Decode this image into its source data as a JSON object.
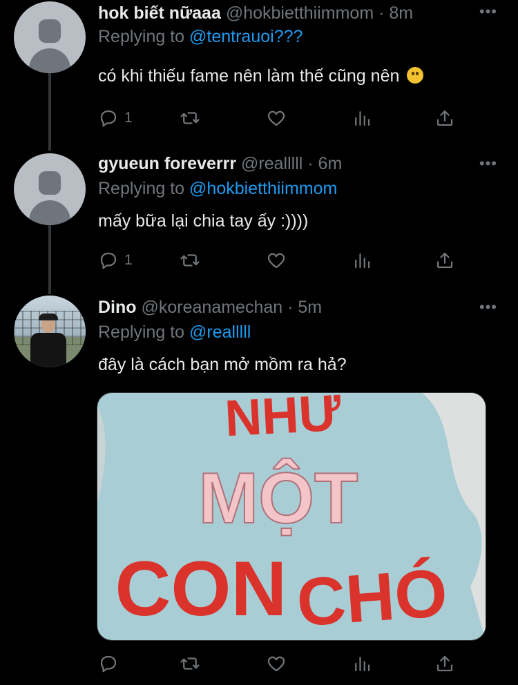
{
  "tweets": [
    {
      "name": "hok biết nữaaa",
      "handle": "@hokbietthiimmom",
      "dot": "·",
      "time": "8m",
      "more": "•••",
      "replying_prefix": "Replying to",
      "replying_to": "@tentrauoi???",
      "text": "có khi thiếu fame nên làm thế cũng nên",
      "emoji": "face-with-open-eyes-and-hand-over-mouth",
      "reply_count": "1",
      "avatar": "default-avatar"
    },
    {
      "name": "gyueun foreverrr",
      "handle": "@realllll",
      "dot": "·",
      "time": "6m",
      "more": "•••",
      "replying_prefix": "Replying to",
      "replying_to": "@hokbietthiimmom",
      "text": "mấy bữa lại chia tay ấy :))))",
      "reply_count": "1",
      "avatar": "default-avatar"
    },
    {
      "name": "Dino",
      "handle": "@koreanamechan",
      "dot": "·",
      "time": "5m",
      "more": "•••",
      "replying_prefix": "Replying to",
      "replying_to": "@realllll",
      "text": "đây là cách bạn mở mồm ra hả?",
      "reply_count": "",
      "avatar": "photo-avatar"
    }
  ],
  "media": {
    "line1": "NHƯ",
    "line2": "MỘT",
    "line3_a": "CON",
    "line3_b": "CHÓ",
    "background": "#a9cdd5",
    "letter_red": "#d9332b",
    "letter_pink": "#f3c5c8"
  },
  "icons": [
    "reply-icon",
    "retweet-icon",
    "like-icon",
    "analytics-icon",
    "share-icon"
  ],
  "colors": {
    "background": "#000000",
    "text": "#e7e9ea",
    "muted": "#71767b",
    "link": "#1d9bf0"
  }
}
